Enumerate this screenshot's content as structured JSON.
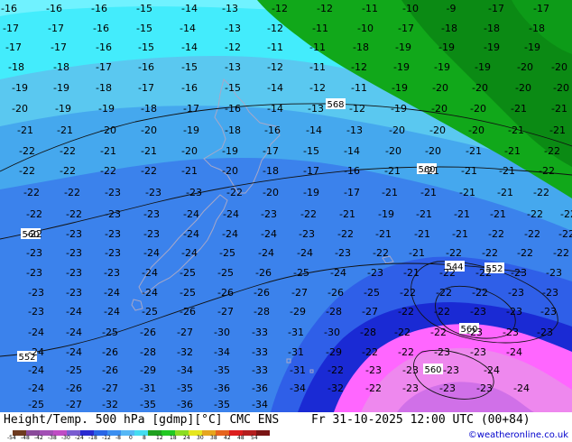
{
  "footer": {
    "title": "Height/Temp. 500 hPa [gdmp][°C] CMC ENS",
    "datetime": "Fr 31-10-2025 12:00 UTC (00+84)",
    "credit": "©weatheronline.co.uk",
    "colorbar_ticks": [
      "-54",
      "-48",
      "-42",
      "-38",
      "-30",
      "-24",
      "-18",
      "-12",
      "-8",
      "0",
      "8",
      "12",
      "18",
      "24",
      "30",
      "38",
      "42",
      "48",
      "54"
    ],
    "colorbar_colors": [
      "#6e3a1f",
      "#8a4a9a",
      "#a24fb4",
      "#c04cc4",
      "#7a5cd0",
      "#2a2ad0",
      "#2a66e6",
      "#3a8ef0",
      "#55b7f5",
      "#45dcf0",
      "#1fa01f",
      "#22c822",
      "#8bdc22",
      "#e6e61e",
      "#e6a51e",
      "#e6641e",
      "#dc1e1e",
      "#b41e1e",
      "#7a1414"
    ]
  },
  "map": {
    "region": "New Zealand",
    "contour_labels": [
      "568",
      "560",
      "560",
      "552",
      "560",
      "552",
      "544",
      "560"
    ],
    "temperature_labels": [
      "-16",
      "-16",
      "-16",
      "-15",
      "-14",
      "-13",
      "-12",
      "-12",
      "-11",
      "-10",
      "-9",
      "-17",
      "-17",
      "-17",
      "-17",
      "-16",
      "-15",
      "-14",
      "-13",
      "-12",
      "-11",
      "-10",
      "-17",
      "-18",
      "-18",
      "-18",
      "-17",
      "-17",
      "-16",
      "-15",
      "-14",
      "-12",
      "-11",
      "-11",
      "-18",
      "-19",
      "-19",
      "-19",
      "-19",
      "-18",
      "-18",
      "-17",
      "-16",
      "-15",
      "-13",
      "-12",
      "-11",
      "-12",
      "-19",
      "-19",
      "-19",
      "-20",
      "-20",
      "-19",
      "-19",
      "-18",
      "-17",
      "-16",
      "-15",
      "-14",
      "-12",
      "-11",
      "-19",
      "-20",
      "-20",
      "-20",
      "-20",
      "-20",
      "-19",
      "-19",
      "-18",
      "-17",
      "-16",
      "-14",
      "-13",
      "-12",
      "-19",
      "-20",
      "-20",
      "-21",
      "-21",
      "-21",
      "-21",
      "-20",
      "-20",
      "-19",
      "-18",
      "-16",
      "-14",
      "-13",
      "-20",
      "-20",
      "-20",
      "-21",
      "-21",
      "-22",
      "-22",
      "-21",
      "-21",
      "-20",
      "-19",
      "-17",
      "-15",
      "-14",
      "-20",
      "-20",
      "-21",
      "-21",
      "-22",
      "-22",
      "-22",
      "-22",
      "-22",
      "-21",
      "-20",
      "-18",
      "-17",
      "-16",
      "-21",
      "-21",
      "-21",
      "-21",
      "-22",
      "-22",
      "-22",
      "-23",
      "-23",
      "-23",
      "-22",
      "-20",
      "-19",
      "-17",
      "-21",
      "-21",
      "-21",
      "-21",
      "-22",
      "-22",
      "-22",
      "-23",
      "-23",
      "-24",
      "-24",
      "-23",
      "-22",
      "-21",
      "-19",
      "-21",
      "-21",
      "-21",
      "-22",
      "-22",
      "-22",
      "-23",
      "-23",
      "-23",
      "-24",
      "-24",
      "-24",
      "-23",
      "-22",
      "-21",
      "-21",
      "-21",
      "-22",
      "-22",
      "-22",
      "-23",
      "-23",
      "-23",
      "-24",
      "-24",
      "-25",
      "-24",
      "-24",
      "-23",
      "-22",
      "-21",
      "-22",
      "-22",
      "-22",
      "-22",
      "-23",
      "-23",
      "-23",
      "-24",
      "-25",
      "-25",
      "-26",
      "-25",
      "-24",
      "-23",
      "-21",
      "-22",
      "-22",
      "-23",
      "-23",
      "-23",
      "-23",
      "-24",
      "-24",
      "-25",
      "-26",
      "-26",
      "-27",
      "-26",
      "-25",
      "-22",
      "-22",
      "-22",
      "-23",
      "-23",
      "-23",
      "-24",
      "-24",
      "-25",
      "-26",
      "-27",
      "-28",
      "-29",
      "-28",
      "-27",
      "-22",
      "-22",
      "-23",
      "-23",
      "-23",
      "-24",
      "-24",
      "-25",
      "-26",
      "-27",
      "-30",
      "-33",
      "-31",
      "-30",
      "-28",
      "-22",
      "-22",
      "-23",
      "-23",
      "-23",
      "-24",
      "-24",
      "-26",
      "-28",
      "-32",
      "-34",
      "-33",
      "-31",
      "-29",
      "-22",
      "-22",
      "-23",
      "-23",
      "-24",
      "-24",
      "-25",
      "-26",
      "-29",
      "-34",
      "-35",
      "-33",
      "-31",
      "-22",
      "-23",
      "-23",
      "-23",
      "-24",
      "-24",
      "-26",
      "-27",
      "-31",
      "-35",
      "-36",
      "-36",
      "-34",
      "-32",
      "-22",
      "-23",
      "-23",
      "-23",
      "-24",
      "-25",
      "-27",
      "-32",
      "-35",
      "-36",
      "-35",
      "-34"
    ]
  }
}
